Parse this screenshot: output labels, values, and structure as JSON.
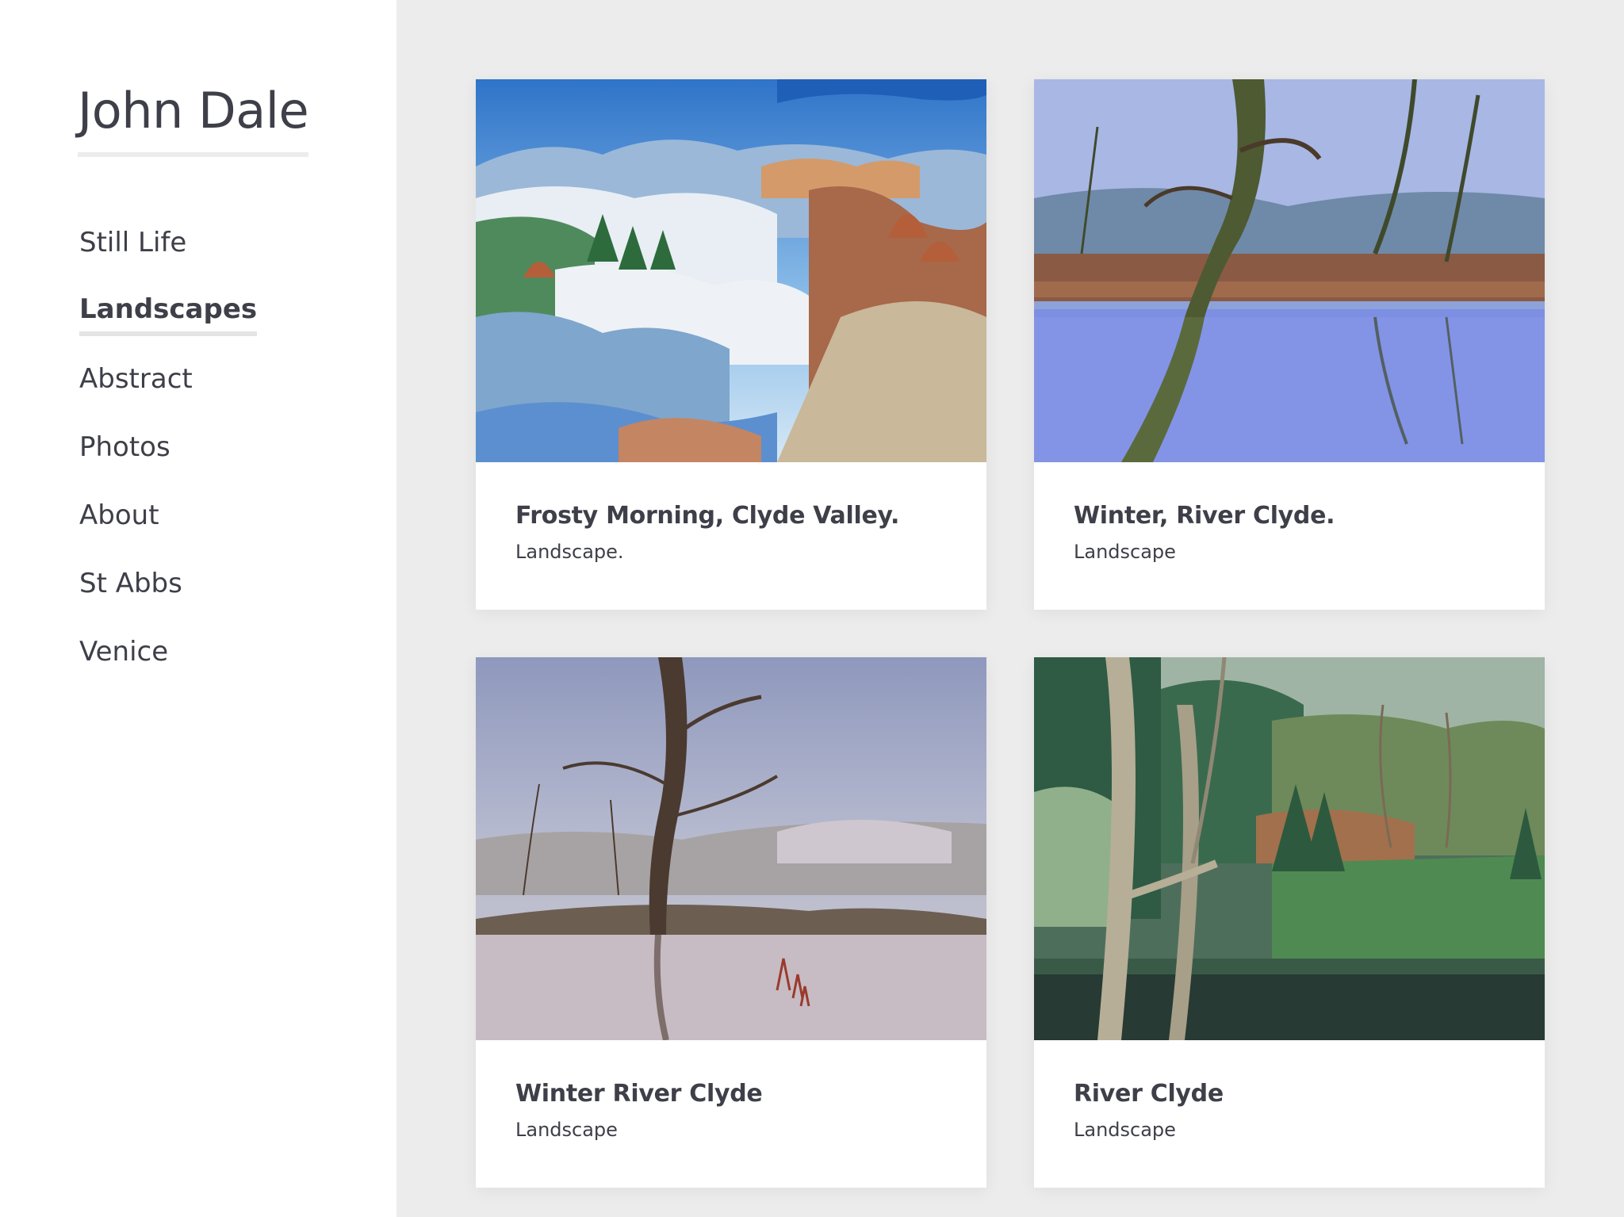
{
  "site": {
    "title": "John Dale"
  },
  "nav": {
    "items": [
      {
        "label": "Still Life"
      },
      {
        "label": "Landscapes"
      },
      {
        "label": "Abstract"
      },
      {
        "label": "Photos"
      },
      {
        "label": "About"
      },
      {
        "label": "St Abbs"
      },
      {
        "label": "Venice"
      }
    ],
    "active": "Landscapes"
  },
  "gallery": {
    "items": [
      {
        "title": "Frosty Morning, Clyde Valley.",
        "category": "Landscape."
      },
      {
        "title": "Winter, River Clyde.",
        "category": "Landscape"
      },
      {
        "title": "Winter River Clyde",
        "category": "Landscape"
      },
      {
        "title": "River Clyde",
        "category": "Landscape"
      }
    ]
  },
  "colors": {
    "text": "#3e3f48",
    "background": "#ececec",
    "panel": "#ffffff",
    "underline": "#e4e4e4"
  }
}
